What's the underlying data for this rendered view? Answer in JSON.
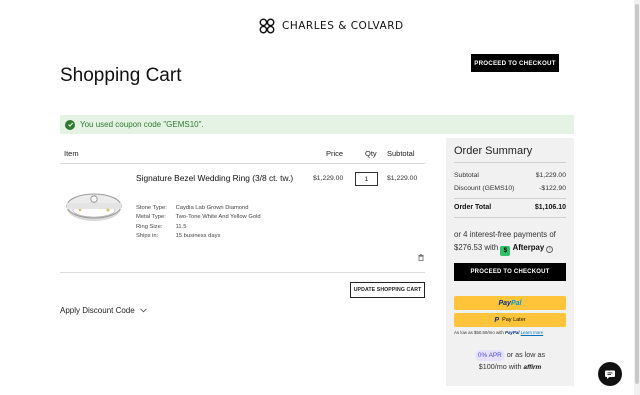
{
  "brand": {
    "name": "CHARLES & COLVARD",
    "logo_icon": "cc-logo-icon"
  },
  "header": {
    "checkout_label": "PROCEED TO CHECKOUT"
  },
  "page": {
    "title": "Shopping Cart"
  },
  "alert": {
    "message": "You used coupon code \"GEMS10\".",
    "color": "#2f7a2f",
    "icon": "check-circle-icon"
  },
  "cart": {
    "columns": {
      "item": "Item",
      "price": "Price",
      "qty": "Qty",
      "subtotal": "Subtotal"
    },
    "items": [
      {
        "name": "Signature Bezel Wedding Ring (3/8 ct. tw.)",
        "price": "$1,229.00",
        "qty": "1",
        "subtotal": "$1,229.00",
        "attributes": [
          {
            "key": "Stone Type:",
            "value": "Caydia Lab Grown Diamond"
          },
          {
            "key": "Metal Type:",
            "value": "Two-Tone White And Yellow Gold"
          },
          {
            "key": "Ring Size:",
            "value": "11.5"
          },
          {
            "key": "Ships in:",
            "value": "15 business days"
          }
        ]
      }
    ],
    "update_label": "UPDATE SHOPPING CART",
    "discount_label": "Apply Discount Code"
  },
  "summary": {
    "title": "Order Summary",
    "rows": [
      {
        "label": "Subtotal",
        "value": "$1,229.00"
      },
      {
        "label": "Discount (GEMS10)",
        "value": "-$122.90"
      }
    ],
    "total": {
      "label": "Order Total",
      "value": "$1,106.10"
    },
    "afterpay": {
      "prefix": "or 4 interest-free payments of",
      "amount": "$276.53",
      "with": "with",
      "badge": "$",
      "brand": "Afterpay",
      "info": "i"
    },
    "checkout_label": "PROCEED TO CHECKOUT",
    "paypal": {
      "pay": "Pay",
      "pal": "Pal",
      "paylater_icon": "P",
      "paylater_label": "Pay Later",
      "note_prefix": "As low as $50.59/mo with",
      "note_brand": "PayPal",
      "learn_more": "Learn more"
    },
    "affirm": {
      "apr_badge": "0% APR",
      "text_1": "or as low as",
      "text_2": "$100/mo with",
      "brand": "affirm"
    }
  },
  "chat": {
    "icon": "chat-bubble-icon"
  }
}
